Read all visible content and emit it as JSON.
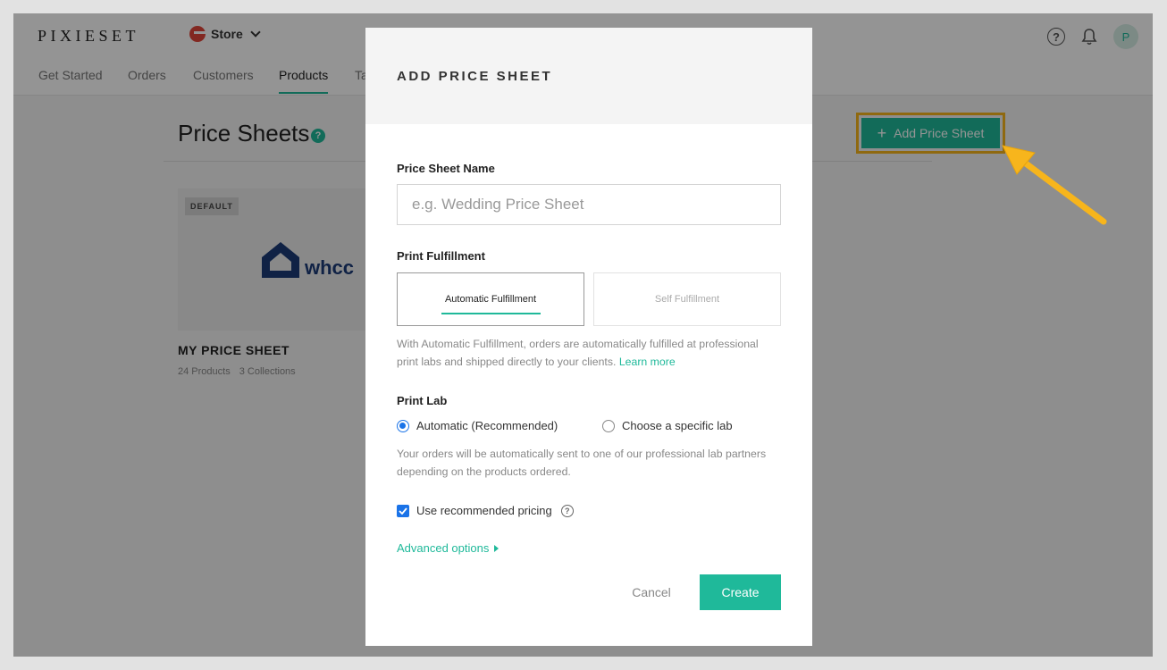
{
  "app": {
    "logo": "PIXIESET",
    "store_label": "Store",
    "avatar_letter": "P",
    "help_glyph": "?"
  },
  "nav": {
    "items": [
      "Get Started",
      "Orders",
      "Customers",
      "Products",
      "Ta"
    ],
    "active": "Products"
  },
  "page": {
    "title": "Price Sheets",
    "title_help": "?",
    "add_button": "Add Price Sheet",
    "add_button_plus": "+"
  },
  "card": {
    "badge": "DEFAULT",
    "lab_logo": "whcc",
    "name": "MY PRICE SHEET",
    "products": "24 Products",
    "collections": "3 Collections"
  },
  "modal": {
    "title": "ADD PRICE SHEET",
    "name_label": "Price Sheet Name",
    "name_placeholder": "e.g. Wedding Price Sheet",
    "name_value": "",
    "fulfillment_label": "Print Fulfillment",
    "fulfillment_tabs": [
      "Automatic Fulfillment",
      "Self Fulfillment"
    ],
    "fulfillment_selected": "Automatic Fulfillment",
    "fulfillment_desc": "With Automatic Fulfillment, orders are automatically fulfilled at professional print labs and shipped directly to your clients.",
    "learn_more": "Learn more",
    "lab_label": "Print Lab",
    "lab_options": [
      "Automatic (Recommended)",
      "Choose a specific lab"
    ],
    "lab_selected": "Automatic (Recommended)",
    "lab_desc": "Your orders will be automatically sent to one of our professional lab partners depending on the products ordered.",
    "pricing_label": "Use recommended pricing",
    "pricing_checked": true,
    "pricing_help": "?",
    "advanced": "Advanced options",
    "cancel": "Cancel",
    "create": "Create"
  },
  "colors": {
    "accent": "#1fb99a",
    "highlight": "#f7b51c",
    "checkbox": "#1a73e8",
    "store_icon": "#e0453a",
    "whcc_blue": "#1c3b78"
  },
  "icons": [
    "store-icon",
    "chevron-down-icon",
    "help-icon",
    "bell-icon",
    "plus-icon",
    "house-logo-icon",
    "radio-icon",
    "checkbox-icon",
    "triangle-right-icon",
    "arrow-pointer-icon"
  ]
}
